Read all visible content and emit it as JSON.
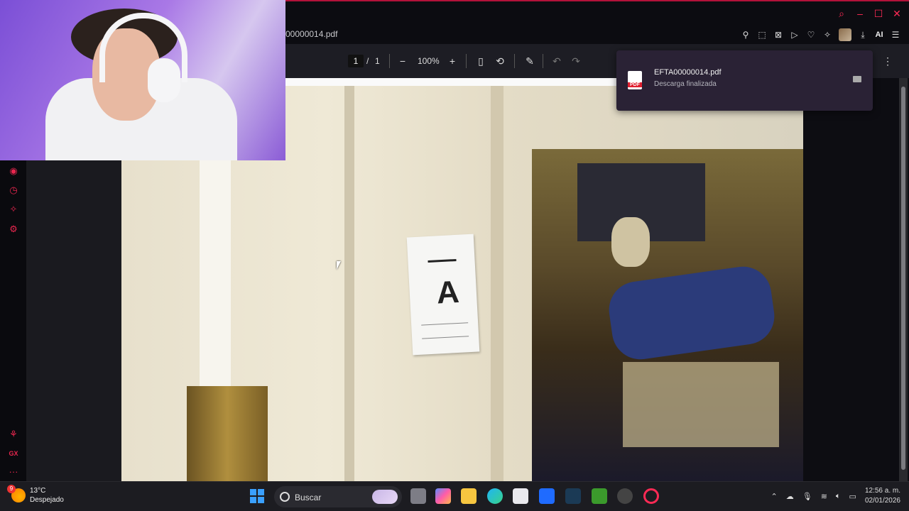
{
  "browser": {
    "tab_title": "00000014.pdf",
    "ai_label": "AI"
  },
  "pdf_toolbar": {
    "page_current": "1",
    "page_separator": "/",
    "page_total": "1",
    "zoom": "100%"
  },
  "download_toast": {
    "filename": "EFTA00000014.pdf",
    "status": "Descarga finalizada",
    "icon_label": "PDF"
  },
  "document": {
    "sign_letter": "A"
  },
  "taskbar": {
    "weather_temp": "13°C",
    "weather_desc": "Despejado",
    "weather_badge": "9",
    "search_label": "Buscar",
    "time": "12:56 a. m.",
    "date": "02/01/2026"
  },
  "sidebar": {
    "gx_label": "GX",
    "more_label": "···"
  },
  "colors": {
    "accent": "#e8264e",
    "toast_bg": "#2a2235",
    "toolbar_bg": "#1d1d24"
  }
}
